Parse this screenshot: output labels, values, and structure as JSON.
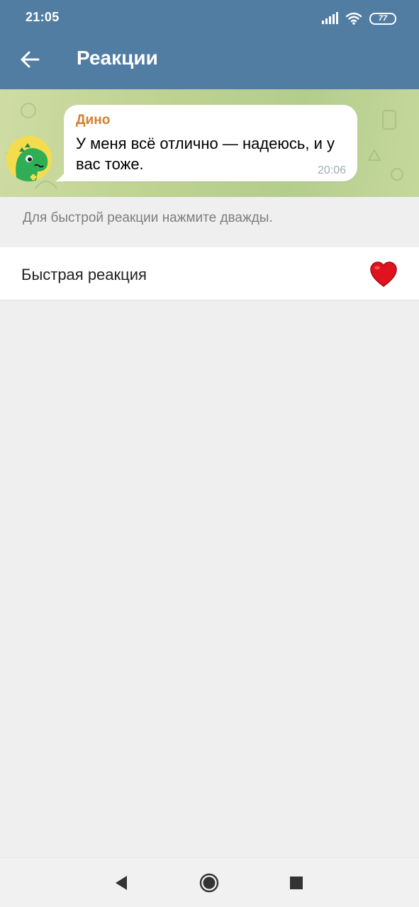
{
  "status_bar": {
    "time": "21:05",
    "battery": "77",
    "icons": [
      "signal-icon",
      "wifi-icon",
      "battery-icon"
    ]
  },
  "header": {
    "title": "Реакции",
    "back_icon": "arrow-left-icon",
    "color": "#527da3"
  },
  "preview": {
    "avatar_icon": "dino-icon",
    "sender": "Дино",
    "sender_color": "#d0822e",
    "message": "У меня всё отлично — надеюсь, и у вас тоже.",
    "time": "20:06"
  },
  "hint": "Для быстрой реакции нажмите дважды.",
  "quick_reaction": {
    "label": "Быстрая реакция",
    "emoji_icon": "red-heart-icon"
  },
  "navigation": {
    "back_icon": "triangle-back-icon",
    "home_icon": "circle-home-icon",
    "recents_icon": "square-recents-icon"
  }
}
